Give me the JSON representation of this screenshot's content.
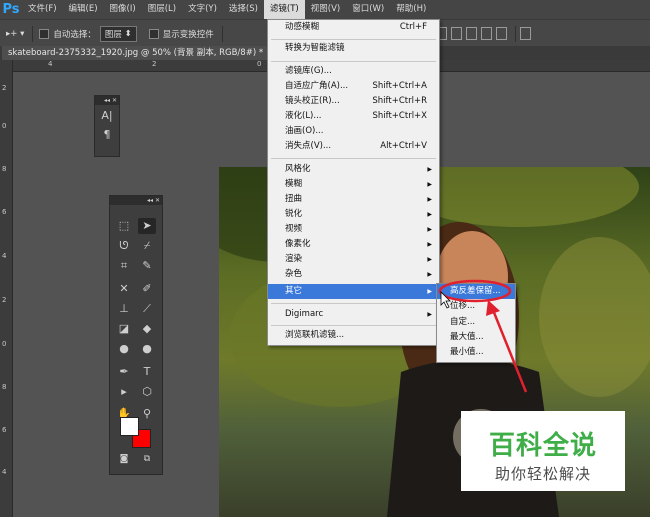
{
  "app": {
    "logo": "Ps"
  },
  "menubar": {
    "items": [
      "文件(F)",
      "编辑(E)",
      "图像(I)",
      "图层(L)",
      "文字(Y)",
      "选择(S)",
      "滤镜(T)",
      "视图(V)",
      "窗口(W)",
      "帮助(H)"
    ],
    "active_index": 6
  },
  "options": {
    "auto_select_label": "自动选择：",
    "auto_select_value": "图层",
    "show_transform_label": "显示变换控件"
  },
  "document": {
    "tab_title": "skateboard-2375332_1920.jpg @ 50% (背景 副本, RGB/8#) * ×"
  },
  "rulers": {
    "h_ticks": [
      "4",
      "2",
      "0"
    ],
    "v_ticks": [
      "2",
      "0",
      "8",
      "6",
      "4",
      "2",
      "0",
      "8",
      "6",
      "4",
      "2",
      "0"
    ]
  },
  "char_panel": {
    "glyph_a": "A|",
    "glyph_p": "¶"
  },
  "filter_menu": {
    "items": [
      {
        "label": "动感模糊",
        "shortcut": "Ctrl+F"
      },
      {
        "label": "转换为智能滤镜"
      },
      {
        "label": "滤镜库(G)..."
      },
      {
        "label": "自适应广角(A)...",
        "shortcut": "Shift+Ctrl+A"
      },
      {
        "label": "镜头校正(R)...",
        "shortcut": "Shift+Ctrl+R"
      },
      {
        "label": "液化(L)...",
        "shortcut": "Shift+Ctrl+X"
      },
      {
        "label": "油画(O)..."
      },
      {
        "label": "消失点(V)...",
        "shortcut": "Alt+Ctrl+V"
      },
      {
        "label": "风格化",
        "submenu": true
      },
      {
        "label": "模糊",
        "submenu": true
      },
      {
        "label": "扭曲",
        "submenu": true
      },
      {
        "label": "锐化",
        "submenu": true
      },
      {
        "label": "视频",
        "submenu": true
      },
      {
        "label": "像素化",
        "submenu": true
      },
      {
        "label": "渲染",
        "submenu": true
      },
      {
        "label": "杂色",
        "submenu": true
      },
      {
        "label": "其它",
        "submenu": true,
        "highlighted": true
      },
      {
        "label": "Digimarc",
        "submenu": true
      },
      {
        "label": "浏览联机滤镜..."
      }
    ]
  },
  "other_submenu": {
    "items": [
      {
        "label": "高反差保留...",
        "highlighted": true
      },
      {
        "label": "位移..."
      },
      {
        "label": "自定..."
      },
      {
        "label": "最大值..."
      },
      {
        "label": "最小值..."
      }
    ]
  },
  "colors": {
    "foreground": "#ffffff",
    "background": "#ff0000",
    "menu_highlight": "#3a78d9",
    "annotation": "#e0202e"
  },
  "watermark": {
    "title": "百科全说",
    "subtitle": "助你轻松解决"
  }
}
